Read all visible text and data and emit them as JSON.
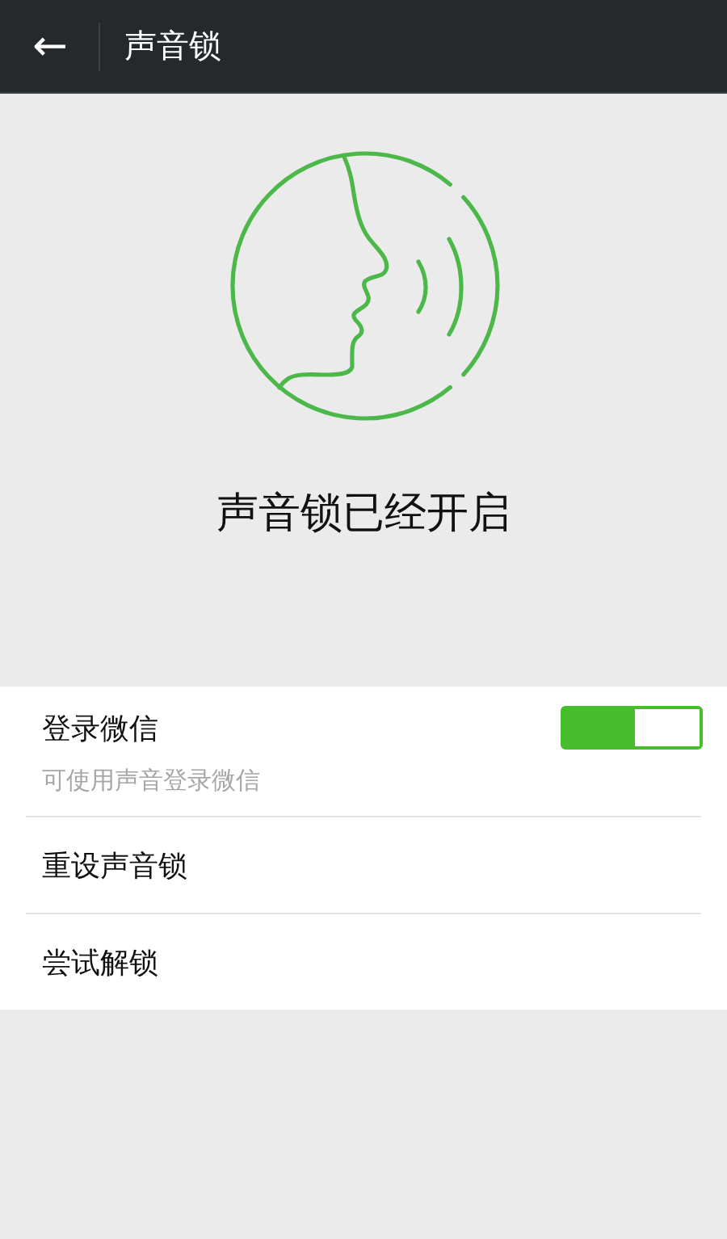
{
  "header": {
    "back_icon": "←",
    "title": "声音锁"
  },
  "status": {
    "text": "声音锁已经开启"
  },
  "settings": [
    {
      "kind": "toggle",
      "label": "登录微信",
      "subtitle": "可使用声音登录微信",
      "on": true
    },
    {
      "kind": "link",
      "label": "重设声音锁"
    },
    {
      "kind": "link",
      "label": "尝试解锁"
    }
  ]
}
